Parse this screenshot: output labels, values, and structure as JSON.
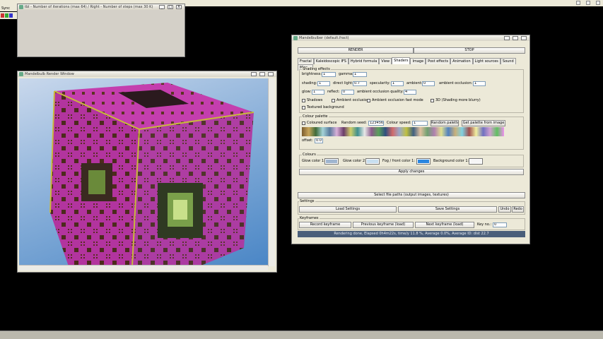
{
  "mini_window": {
    "title": "tbl - Number of iterations (max 64) / Right - Number of steps (max 30 K)",
    "controls": [
      "_",
      "□",
      "X"
    ]
  },
  "top_menu": {
    "item": "Sync"
  },
  "render_window": {
    "title": "Mandelbulb Render Window"
  },
  "main_window": {
    "title": "Mandelbulber (default.fract)",
    "render_label": "RENDER",
    "stop_label": "STOP",
    "tabs": [
      "Fractal",
      "Kaleidoscopic IFS",
      "Hybrid formula",
      "View",
      "Shaders",
      "Image",
      "Post effects",
      "Animation",
      "Light sources",
      "Sound",
      "Misc..."
    ],
    "active_tab": "Shaders",
    "shading": {
      "group_label": "Shading effects",
      "brightness_label": "brightness:",
      "brightness_value": "1",
      "gamma_label": "gamma:",
      "gamma_value": "1",
      "shading_label": "shading:",
      "shading_value": "1",
      "direct_label": "direct light:",
      "direct_value": "0.7",
      "specularity_label": "specularity:",
      "specularity_value": "1",
      "ambient_label": "ambient:",
      "ambient_value": "0",
      "ambient_occ_label": "ambient occlusion:",
      "ambient_occ_value": "1",
      "glow_label": "glow:",
      "glow_value": "1",
      "reflect_label": "reflect:",
      "reflect_value": "0",
      "ao_quality_label": "ambient occlusion quality:",
      "ao_quality_value": "4",
      "shadows_label": "Shadows",
      "ambient_occlusion_check_label": "Ambient occlusion",
      "fast_ao_label": "Ambient occlusion fast mode",
      "3d_label": "3D (Shading more blurry)",
      "textured_bg_label": "Textured background"
    },
    "palette": {
      "group_label": "Colour palette",
      "coloured_label": "Coloured surface",
      "seed_label": "Random seed:",
      "seed_value": "123456",
      "speed_label": "Colour speed:",
      "speed_value": "1",
      "random_palette_label": "Random palette",
      "get_palette_label": "Get palette from image",
      "offset_label": "offset:",
      "offset_value": "0.0"
    },
    "colors": {
      "group_label": "Colours",
      "glow1_label": "Glow color 1:",
      "glow1_color": "#9fb5cf",
      "glow2_label": "Glow color 2:",
      "glow2_color": "#c8dff0",
      "fog_label": "Fog / front color 1:",
      "fog_color": "#2a86e0",
      "background_label": "Background color 1:",
      "background_color": "#f6f6f6",
      "apply_label": "Apply changes"
    },
    "select_files_label": "Select file paths (output images, textures)",
    "settings": {
      "group_label": "Settings",
      "load_label": "Load Settings",
      "save_label": "Save Settings",
      "undo_label": "Undo",
      "redo_label": "Redo"
    },
    "keyframes": {
      "group_label": "Keyframes",
      "record_label": "Record keyframe",
      "previous_label": "Previous keyframe (load)",
      "next_label": "Next keyframe (load)",
      "number_label": "Key no.:",
      "number_value": "0"
    },
    "status": "Rendering done, Elapsed 0h4m22s, time/y 11.8 %, Average 0.0%, Average ID: dist 22.7"
  }
}
